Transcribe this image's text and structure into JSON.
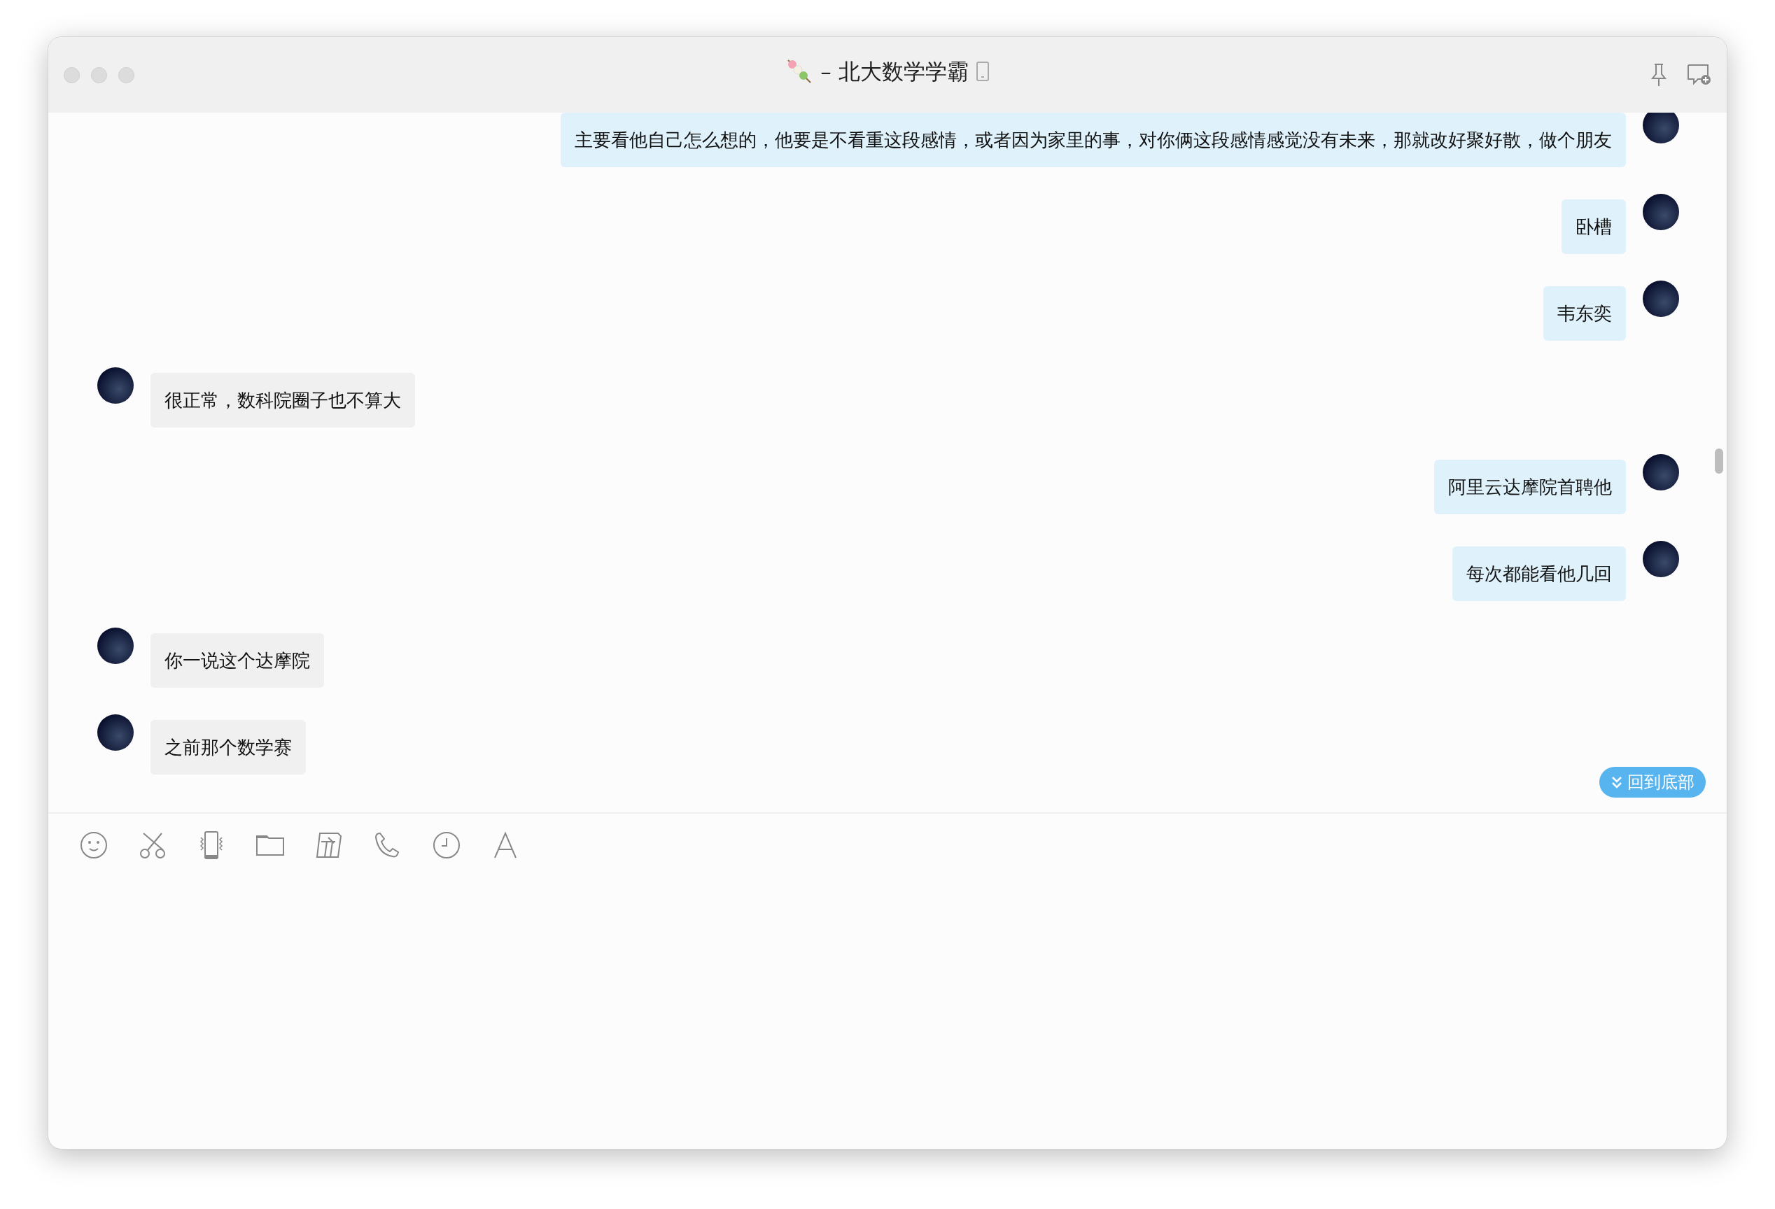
{
  "window": {
    "title": "– 北大数学学霸"
  },
  "messages": [
    {
      "kind": "sent",
      "text": "主要看他自己怎么想的，他要是不看重这段感情，或者因为家里的事，对你俩这段感情感觉没有未来，那就改好聚好散，做个朋友"
    },
    {
      "kind": "sent",
      "text": "卧槽"
    },
    {
      "kind": "sent",
      "text": "韦东奕"
    },
    {
      "kind": "received",
      "text": "很正常，数科院圈子也不算大"
    },
    {
      "kind": "sent",
      "text": "阿里云达摩院首聘他"
    },
    {
      "kind": "sent",
      "text": "每次都能看他几回"
    },
    {
      "kind": "received",
      "text": "你一说这个达摩院"
    },
    {
      "kind": "received",
      "text": "之前那个数学赛"
    }
  ],
  "scroll_button": {
    "label": "回到底部"
  }
}
